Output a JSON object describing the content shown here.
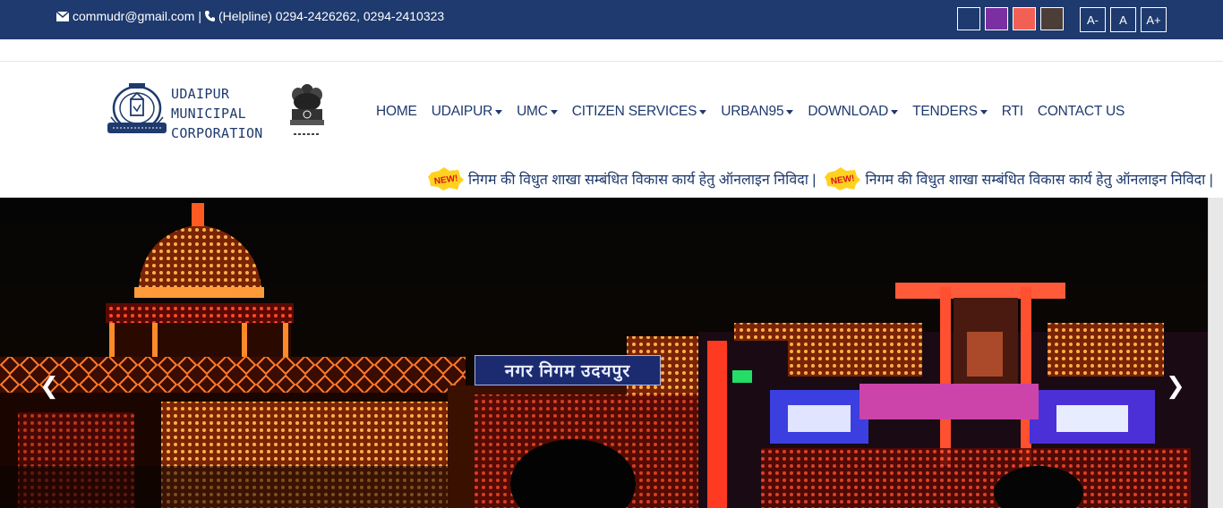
{
  "topbar": {
    "email": "commudr@gmail.com",
    "separator": "|",
    "helpline": "(Helpline) 0294-2426262, 0294-2410323",
    "theme_swatches": [
      "#1e3a6e",
      "#7b2fa0",
      "#f26055",
      "#4a3e36"
    ],
    "font_size_buttons": [
      "A-",
      "A",
      "A+"
    ]
  },
  "logo": {
    "line1": "UDAIPUR",
    "line2": "MUNICIPAL",
    "line3": "CORPORATION"
  },
  "nav": {
    "items": [
      {
        "label": "HOME",
        "dropdown": false
      },
      {
        "label": "UDAIPUR",
        "dropdown": true
      },
      {
        "label": "UMC",
        "dropdown": true
      },
      {
        "label": "CITIZEN SERVICES",
        "dropdown": true
      },
      {
        "label": "URBAN95",
        "dropdown": true
      },
      {
        "label": "DOWNLOAD",
        "dropdown": true
      },
      {
        "label": "TENDERS",
        "dropdown": true
      },
      {
        "label": "RTI",
        "dropdown": false
      },
      {
        "label": "CONTACT US",
        "dropdown": false
      }
    ]
  },
  "marquee": {
    "badge": "NEW!",
    "items": [
      "निगम की विधुत शाखा सम्बंधित विकास कार्य हेतु ऑनलाइन निविदा |",
      "निगम की विधुत शाखा सम्बंधित विकास कार्य हेतु ऑनलाइन निविदा |"
    ]
  },
  "slider": {
    "prev_arrow": "❮",
    "next_arrow": "❯",
    "board_text": "नगर निगम उदयपुर"
  },
  "colors": {
    "brand": "#1e3a6e",
    "accent_lights": "#ff8a2a"
  }
}
